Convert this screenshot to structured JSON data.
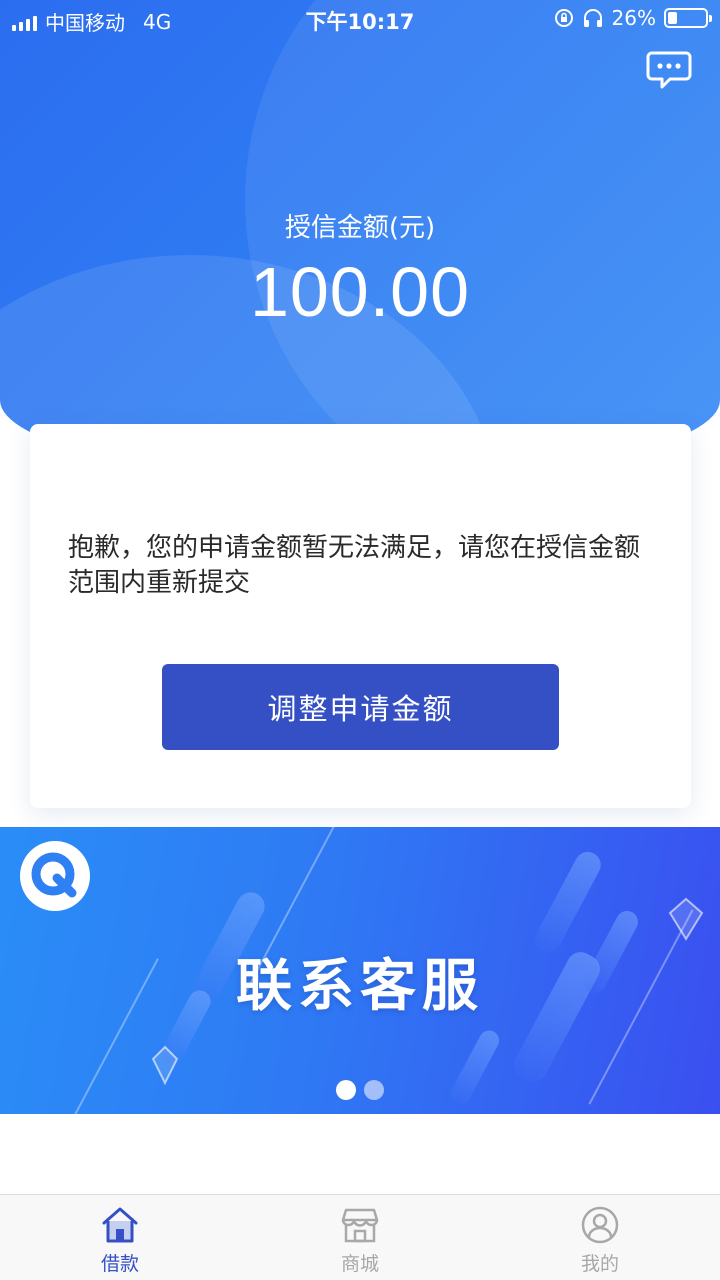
{
  "status_bar": {
    "carrier": "中国移动",
    "network": "4G",
    "time": "下午10:17",
    "battery_percent": "26%",
    "battery_level": 0.26
  },
  "header": {
    "chat_icon": "chat-bubble-icon",
    "credit_label": "授信金额(元)",
    "credit_amount": "100.00"
  },
  "card": {
    "message": "抱歉，您的申请金额暂无法满足，请您在授信金额范围内重新提交",
    "adjust_button": "调整申请金额"
  },
  "banner": {
    "logo_icon": "search-logo-icon",
    "title": "联系客服",
    "active_slide": 1,
    "slide_count": 2
  },
  "tabbar": {
    "items": [
      {
        "label": "借款",
        "icon": "home-icon",
        "active": true
      },
      {
        "label": "商城",
        "icon": "store-icon",
        "active": false
      },
      {
        "label": "我的",
        "icon": "user-icon",
        "active": false
      }
    ]
  },
  "colors": {
    "primary_blue": "#2f80f3",
    "button_blue": "#3550c5",
    "tab_inactive": "#a8a8a8"
  }
}
